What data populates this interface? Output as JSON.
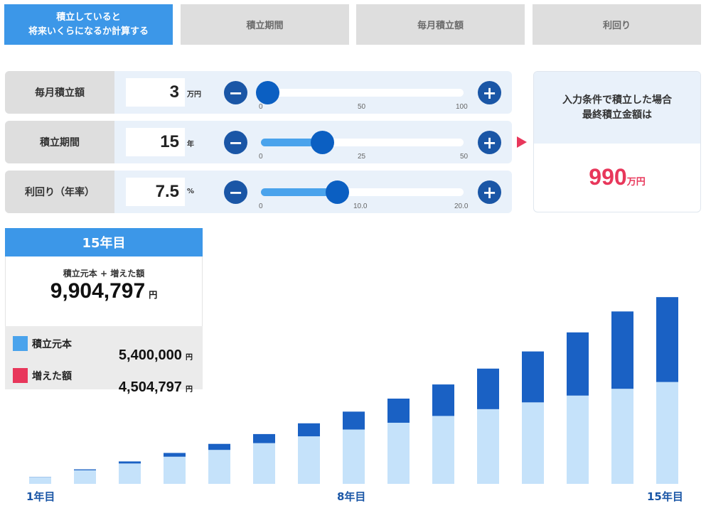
{
  "tabs": [
    {
      "line1": "積立していると",
      "line2": "将来いくらになるか計算する",
      "active": true
    },
    {
      "label": "積立期間"
    },
    {
      "label": "毎月積立額"
    },
    {
      "label": "利回り"
    }
  ],
  "inputs": [
    {
      "label": "毎月積立額",
      "value": "3",
      "unit": "万円",
      "ticks": [
        "0",
        "50",
        "100"
      ],
      "slider_fraction": 0.03
    },
    {
      "label": "積立期間",
      "value": "15",
      "unit": "年",
      "ticks": [
        "0",
        "25",
        "50"
      ],
      "slider_fraction": 0.3
    },
    {
      "label": "利回り（年率）",
      "value": "7.5",
      "unit": "%",
      "ticks": [
        "0",
        "10.0",
        "20.0"
      ],
      "slider_fraction": 0.375
    }
  ],
  "buttons": {
    "minus": "−",
    "plus": "+"
  },
  "result": {
    "heading_line1": "入力条件で積立した場合",
    "heading_line2": "最終積立金額は",
    "value": "990",
    "unit": "万円"
  },
  "info": {
    "title": "15年目",
    "sublabel": "積立元本 + 増えた額",
    "total": "9,904,797",
    "total_unit": "円",
    "principal_label": "積立元本",
    "principal_value": "5,400,000",
    "gain_label": "増えた額",
    "gain_value": "4,504,797",
    "unit": "円"
  },
  "colors": {
    "principal": "#c5e2fa",
    "gain": "#1a61c4",
    "legend_principal": "#4aa3ec",
    "legend_gain": "#e8375b",
    "accent": "#3c97e8",
    "result": "#e8375b"
  },
  "chart_data": {
    "type": "bar",
    "stacked": true,
    "categories": [
      "1年目",
      "2年目",
      "3年目",
      "4年目",
      "5年目",
      "6年目",
      "7年目",
      "8年目",
      "9年目",
      "10年目",
      "11年目",
      "12年目",
      "13年目",
      "14年目",
      "15年目"
    ],
    "x_tick_labels_shown": [
      "1年目",
      "8年目",
      "15年目"
    ],
    "series": [
      {
        "name": "積立元本",
        "values": [
          36,
          72,
          108,
          144,
          180,
          216,
          252,
          288,
          324,
          360,
          396,
          432,
          468,
          504,
          540
        ]
      },
      {
        "name": "増えた額",
        "values": [
          1,
          5,
          11,
          20,
          32,
          48,
          69,
          95,
          128,
          167,
          215,
          270,
          335,
          410,
          450
        ]
      }
    ],
    "unit": "万円"
  }
}
